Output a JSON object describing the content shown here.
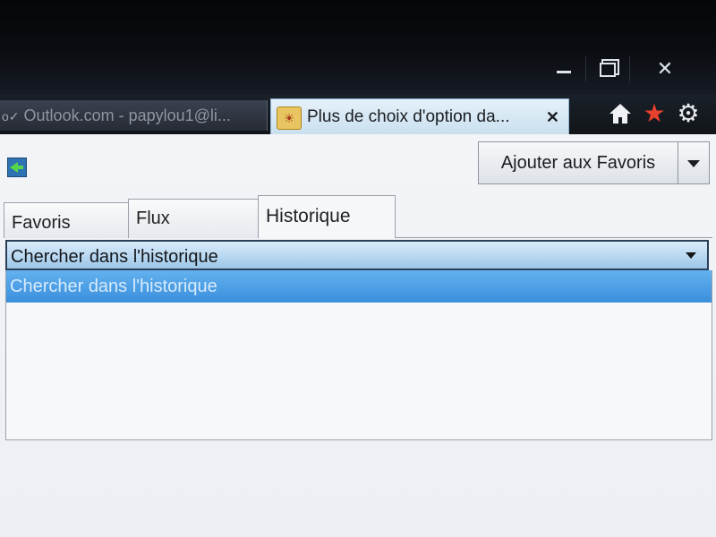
{
  "window": {
    "minimize_icon": "minimize-icon",
    "maximize_icon": "restore-icon",
    "close_glyph": "✕"
  },
  "tabs": {
    "inactive": {
      "title": "Outlook.com - papylou1@li..."
    },
    "active": {
      "title": "Plus de choix d'option da...",
      "close_glyph": "✕"
    }
  },
  "toolbar": {
    "home_icon": "home-icon",
    "favorites_icon": "star-icon",
    "tools_icon": "gear-icon",
    "star_color": "#e8412d"
  },
  "favorites_center": {
    "add_button_label": "Ajouter aux Favoris",
    "tabs": [
      {
        "label": "Favoris"
      },
      {
        "label": "Flux"
      },
      {
        "label": "Historique"
      }
    ],
    "history": {
      "selected_value": "Chercher dans l'historique",
      "options": [
        "Chercher dans l'historique"
      ]
    }
  },
  "colors": {
    "accent": "#3a8fdc",
    "active_tab": "#d6e8f5"
  }
}
